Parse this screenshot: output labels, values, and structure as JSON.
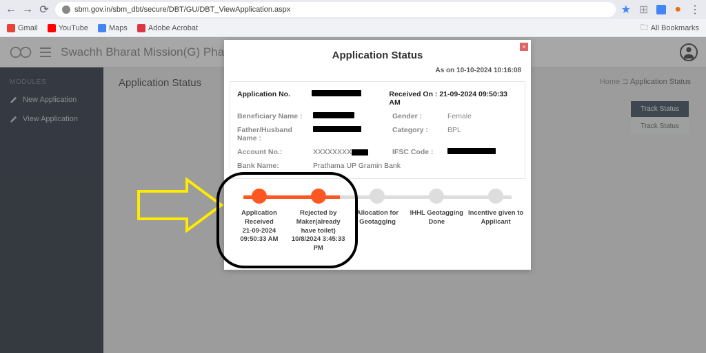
{
  "browser": {
    "url": "sbm.gov.in/sbm_dbt/secure/DBT/GU/DBT_ViewApplication.aspx",
    "bookmarks": [
      "Gmail",
      "YouTube",
      "Maps",
      "Adobe Acrobat"
    ],
    "all_bookmarks": "All Bookmarks"
  },
  "app": {
    "title": "Swachh Bharat Mission(G) Pha"
  },
  "sidebar": {
    "header": "MODULES",
    "items": [
      "New Application",
      "View Application"
    ]
  },
  "page": {
    "title": "Application Status",
    "breadcrumb_home": "Home",
    "breadcrumb_current": "Application Status",
    "track1": "Track Status",
    "track2": "Track Status"
  },
  "modal": {
    "title": "Application Status",
    "as_on": "As on 10-10-2024 10:16:08",
    "app_no_label": "Application No.",
    "received_label": "Received On : 21-09-2024 09:50:33 AM",
    "rows": {
      "ben_label": "Beneficiary Name :",
      "gender_label": "Gender :",
      "gender_val": "Female",
      "fh_label": "Father/Husband Name :",
      "cat_label": "Category :",
      "cat_val": "BPL",
      "acc_label": "Account No.:",
      "acc_val": "XXXXXXXX",
      "ifsc_label": "IFSC Code :",
      "bank_label": "Bank Name:",
      "bank_val": "Prathama UP Gramin Bank"
    },
    "steps": [
      "Application Received<br>21-09-2024<br>09:50:33 AM",
      "Rejected by Maker(already have toilet)<br>10/8/2024 3:45:33 PM",
      "Allocation for Geotagging",
      "IHHL Geotagging Done",
      "Incentive given to Applicant"
    ]
  }
}
